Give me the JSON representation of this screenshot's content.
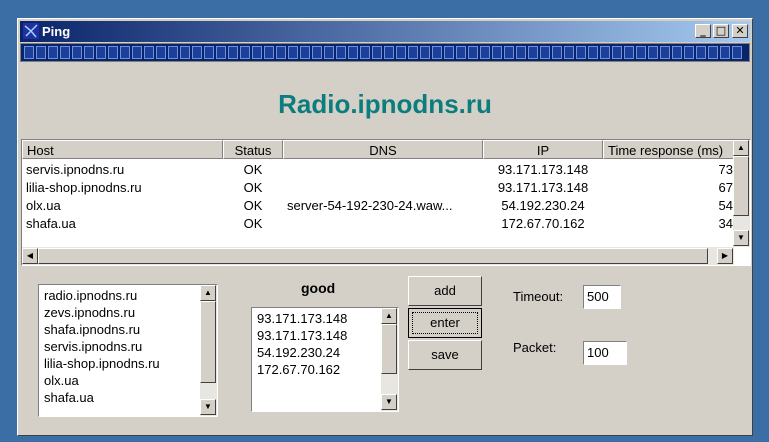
{
  "window": {
    "title": "Ping",
    "minimize": "_",
    "maximize": "□",
    "close": "✕"
  },
  "headline": "Radio.ipnodns.ru",
  "table": {
    "columns": [
      "Host",
      "Status",
      "DNS",
      "IP",
      "Time response (ms)"
    ],
    "rows": [
      {
        "host": "servis.ipnodns.ru",
        "status": "OK",
        "dns": "",
        "ip": "93.171.173.148",
        "time": "73"
      },
      {
        "host": "lilia-shop.ipnodns.ru",
        "status": "OK",
        "dns": "",
        "ip": "93.171.173.148",
        "time": "67"
      },
      {
        "host": "olx.ua",
        "status": "OK",
        "dns": "server-54-192-230-24.waw...",
        "ip": "54.192.230.24",
        "time": "54"
      },
      {
        "host": "shafa.ua",
        "status": "OK",
        "dns": "",
        "ip": "172.67.70.162",
        "time": "34"
      }
    ]
  },
  "hosts_list": [
    "radio.ipnodns.ru",
    "zevs.ipnodns.ru",
    "shafa.ipnodns.ru",
    "servis.ipnodns.ru",
    "lilia-shop.ipnodns.ru",
    "olx.ua",
    "shafa.ua"
  ],
  "good_label": "good",
  "good_list": [
    "93.171.173.148",
    "93.171.173.148",
    "54.192.230.24",
    "172.67.70.162"
  ],
  "buttons": {
    "add": "add",
    "enter": "enter",
    "save": "save"
  },
  "timeout": {
    "label": "Timeout:",
    "value": "500"
  },
  "packet": {
    "label": "Packet:",
    "value": "100"
  },
  "colors": {
    "headline": "#0b7d7d",
    "titlebar": "#0a246a",
    "desktop": "#3a6ea5"
  }
}
